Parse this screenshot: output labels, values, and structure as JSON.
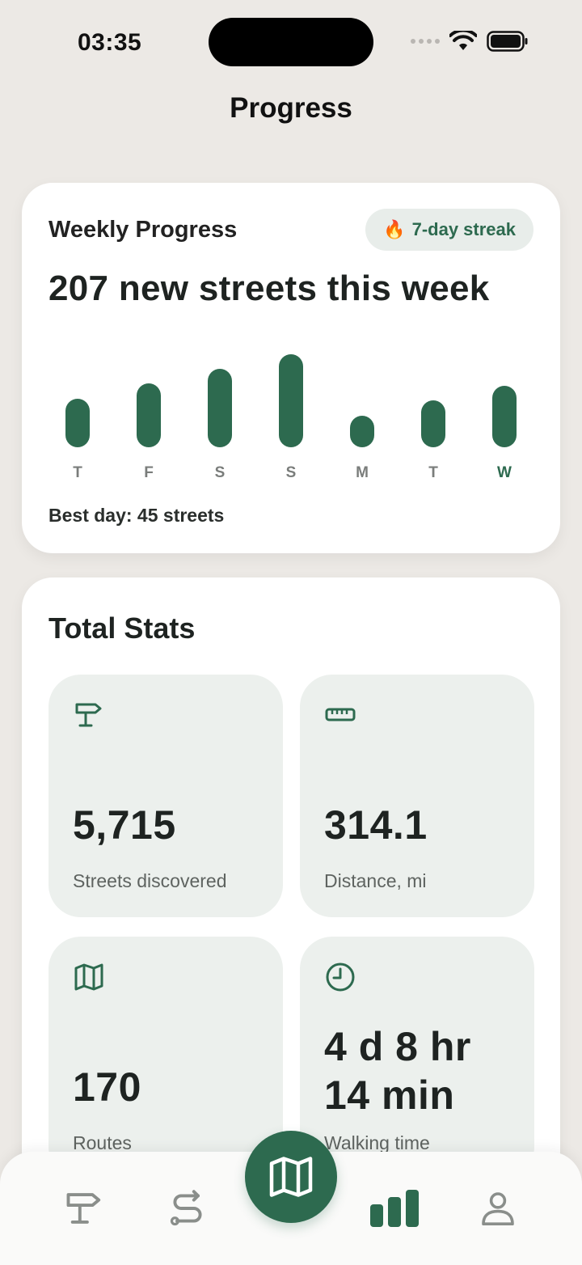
{
  "status_bar": {
    "time": "03:35"
  },
  "header": {
    "title": "Progress"
  },
  "weekly": {
    "title": "Weekly Progress",
    "streak": "7-day streak",
    "headline": "207 new streets this week",
    "best_day": "Best day: 45 streets",
    "accent_color": "#2D6A4F"
  },
  "chart_data": {
    "type": "bar",
    "categories": [
      "T",
      "F",
      "S",
      "S",
      "M",
      "T",
      "W"
    ],
    "values": [
      23,
      30,
      37,
      44,
      15,
      22,
      29
    ],
    "highlighted_category": "W",
    "ylim": [
      0,
      45
    ],
    "grid": false
  },
  "stats": {
    "title": "Total Stats",
    "tiles": [
      {
        "icon": "signpost-icon",
        "value": "5,715",
        "label": "Streets discovered"
      },
      {
        "icon": "ruler-icon",
        "value": "314.1",
        "label": "Distance, mi"
      },
      {
        "icon": "map-icon",
        "value": "170",
        "label": "Routes"
      },
      {
        "icon": "clock-icon",
        "value_line1": "4 d 8 hr",
        "value_line2": "14 min",
        "label": "Walking time"
      }
    ]
  },
  "tab_bar": {
    "tabs": [
      {
        "icon": "signpost-icon",
        "active": false
      },
      {
        "icon": "route-icon",
        "active": false
      },
      {
        "icon": "map-icon",
        "active": false
      },
      {
        "icon": "bar-chart-icon",
        "active": true
      },
      {
        "icon": "person-icon",
        "active": false
      }
    ]
  }
}
